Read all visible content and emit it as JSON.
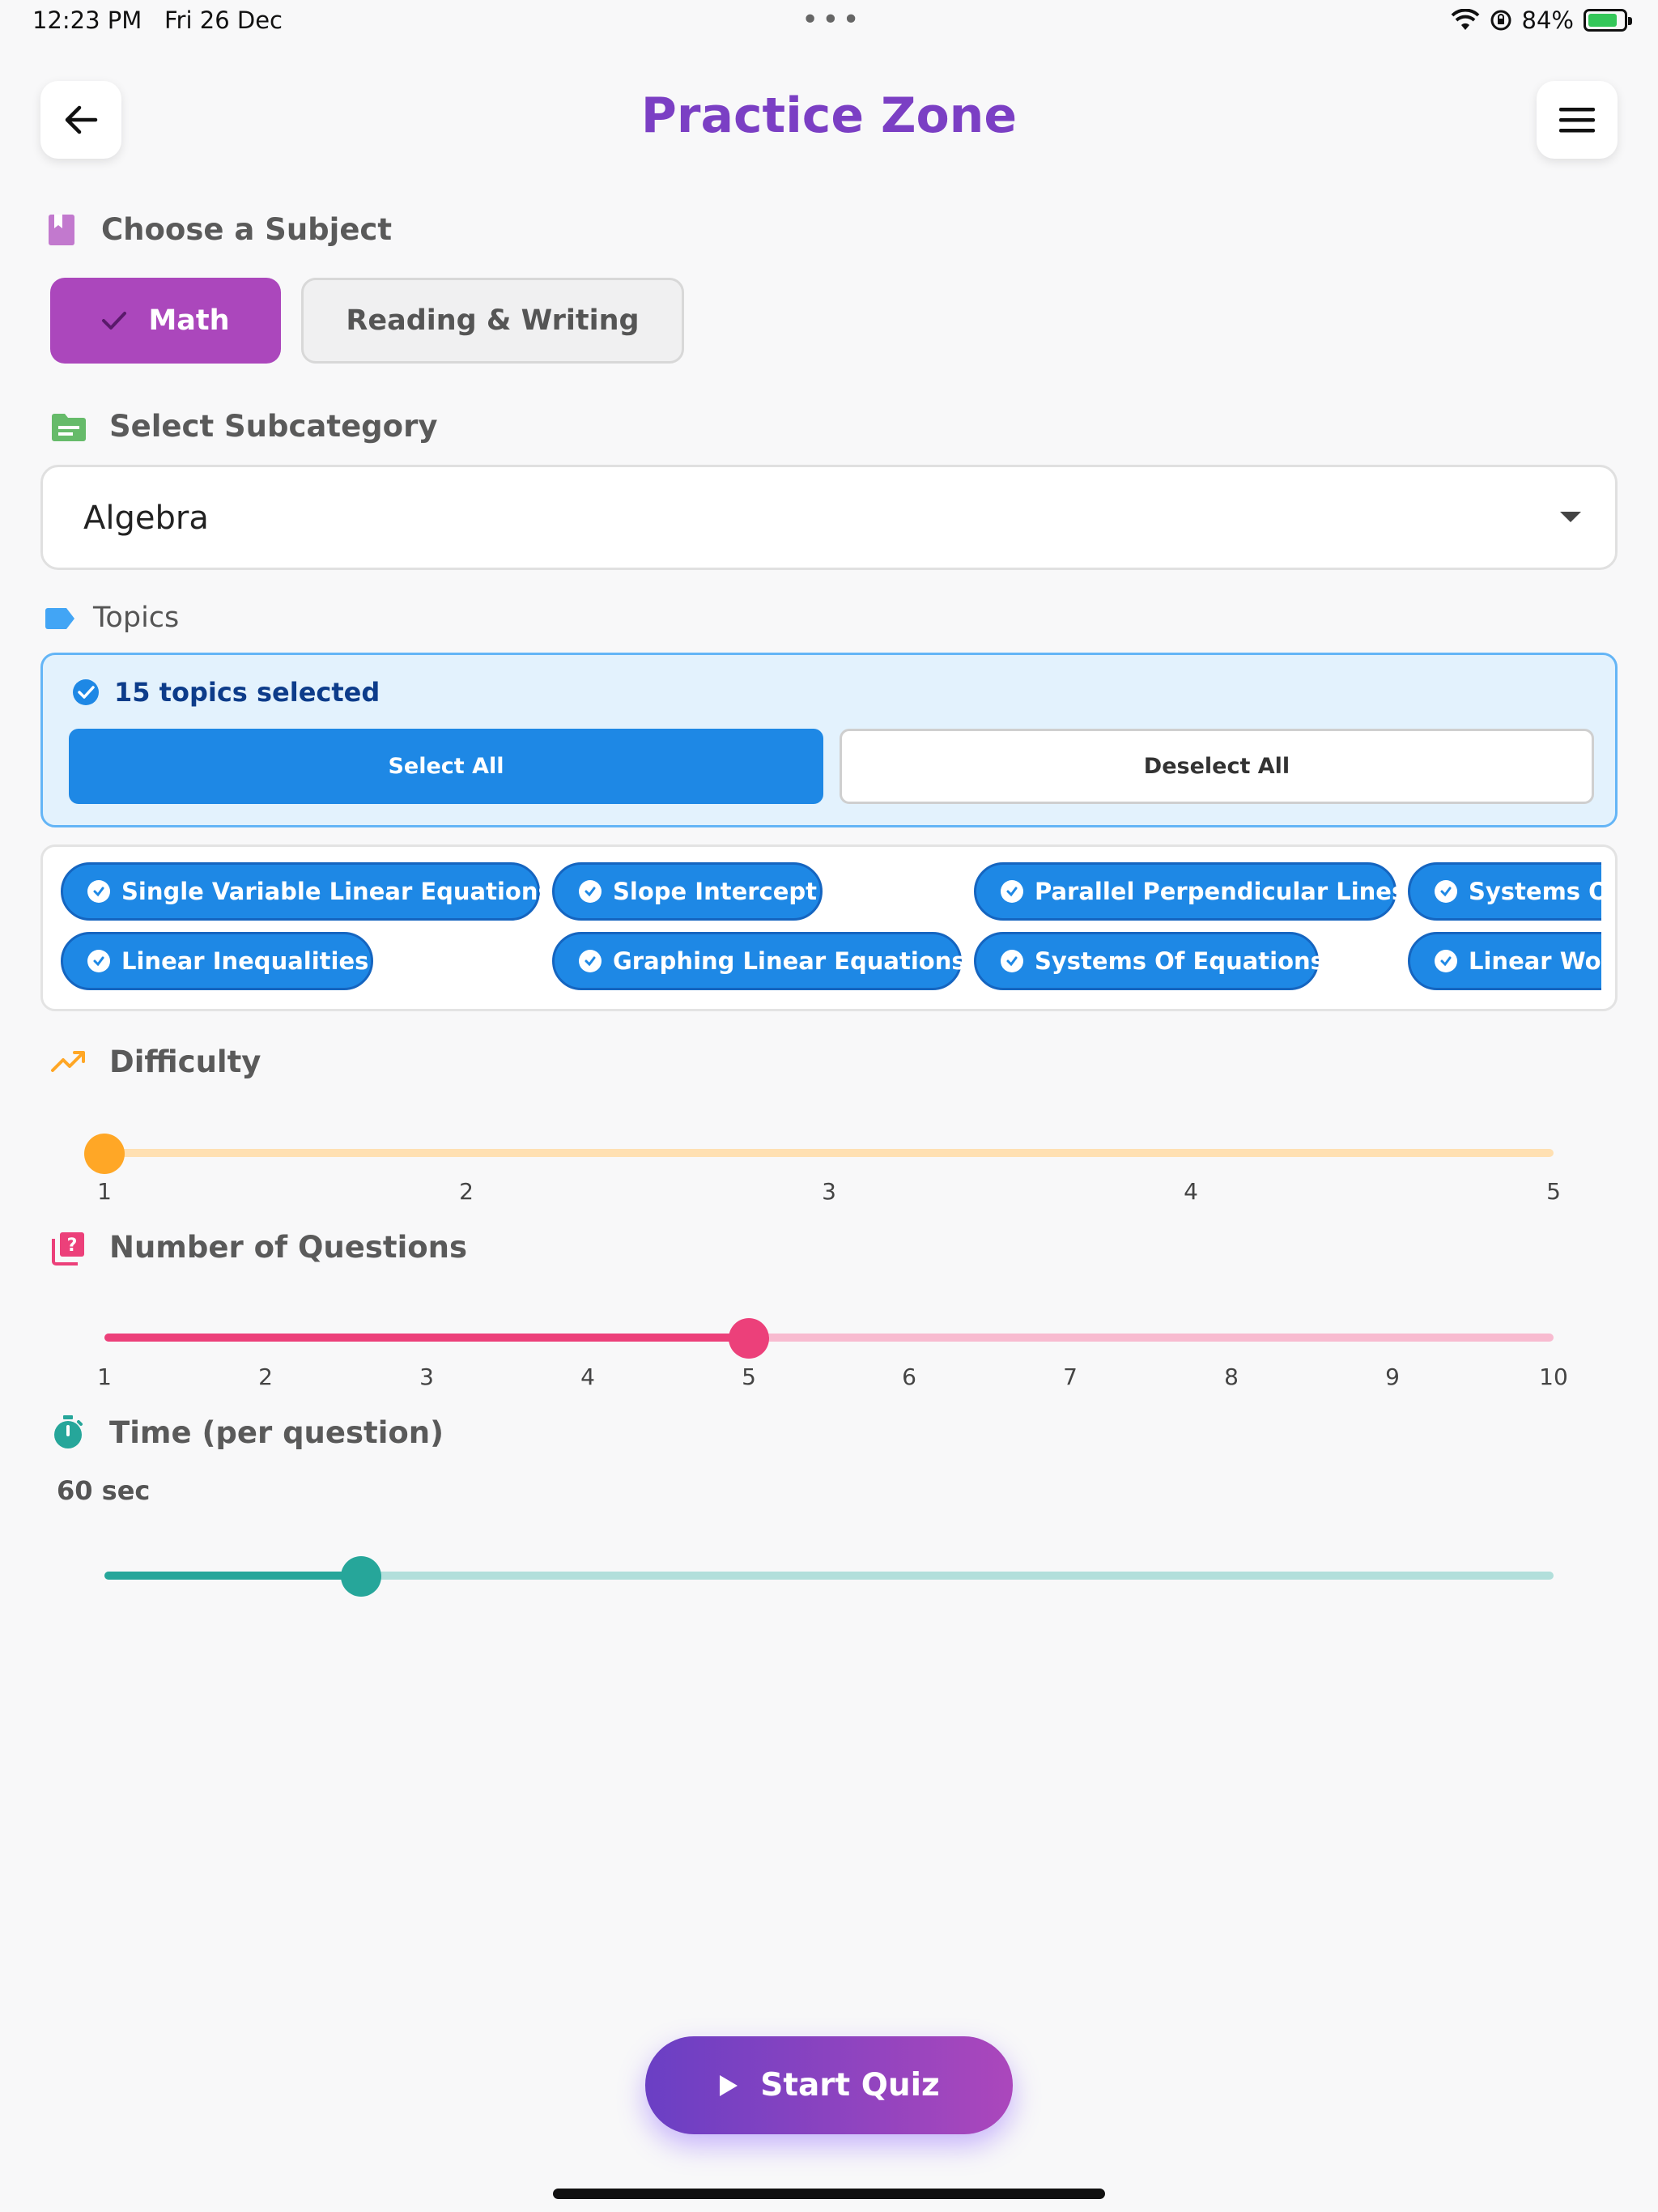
{
  "status_bar": {
    "time": "12:23 PM",
    "date": "Fri 26 Dec",
    "dots": "•••",
    "battery": "84%"
  },
  "header": {
    "title": "Practice Zone",
    "back_icon": "arrow-left-icon",
    "menu_icon": "hamburger-menu-icon"
  },
  "subject": {
    "label": "Choose a Subject",
    "options": [
      {
        "label": "Math",
        "selected": true
      },
      {
        "label": "Reading & Writing",
        "selected": false
      }
    ]
  },
  "subcategory": {
    "label": "Select Subcategory",
    "value": "Algebra"
  },
  "topics": {
    "label": "Topics",
    "selected_text": "15 topics selected",
    "select_all": "Select All",
    "deselect_all": "Deselect All",
    "chips": [
      "Single Variable Linear Equations",
      "Slope Intercept",
      "Parallel Perpendicular Lines",
      "Systems Of",
      "Linear Inequalities",
      "Graphing Linear Equations",
      "Systems Of Equations",
      "Linear Wor"
    ]
  },
  "difficulty": {
    "label": "Difficulty",
    "value": 1,
    "min": 1,
    "max": 5,
    "ticks": [
      "1",
      "2",
      "3",
      "4",
      "5"
    ],
    "color": "#ffa726"
  },
  "questions": {
    "label": "Number of Questions",
    "value": 5,
    "min": 1,
    "max": 10,
    "ticks": [
      "1",
      "2",
      "3",
      "4",
      "5",
      "6",
      "7",
      "8",
      "9",
      "10"
    ],
    "color": "#ec407a"
  },
  "time": {
    "label": "Time (per question)",
    "value_text": "60 sec",
    "fraction": 0.177,
    "color": "#26a69a"
  },
  "start_button": {
    "label": "Start Quiz"
  },
  "colors": {
    "accent": "#7b3fc4",
    "math_chip": "#ab47bc",
    "blue": "#1e88e5"
  }
}
